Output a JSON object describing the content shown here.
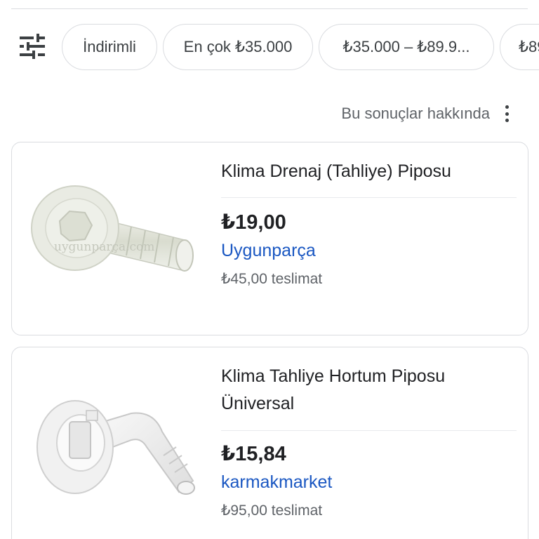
{
  "filters": {
    "icon": "tune-icon",
    "chips": [
      "İndirimli",
      "En çok ₺35.000",
      "₺35.000 – ₺89.9...",
      "₺89"
    ]
  },
  "about": {
    "label": "Bu sonuçlar hakkında",
    "menu_icon": "more-vert-icon"
  },
  "products": [
    {
      "title": "Klima Drenaj (Tahliye) Piposu",
      "price": "₺19,00",
      "merchant": "Uygunparça",
      "shipping": "₺45,00 teslimat",
      "watermark": "uygunparça.com"
    },
    {
      "title": "Klima Tahliye Hortum Piposu Üniversal",
      "price": "₺15,84",
      "merchant": "karmakmarket",
      "shipping": "₺95,00 teslimat"
    }
  ],
  "colors": {
    "link": "#1a57c2",
    "border": "#dadce0",
    "text": "#202124",
    "secondary": "#5f6368"
  }
}
